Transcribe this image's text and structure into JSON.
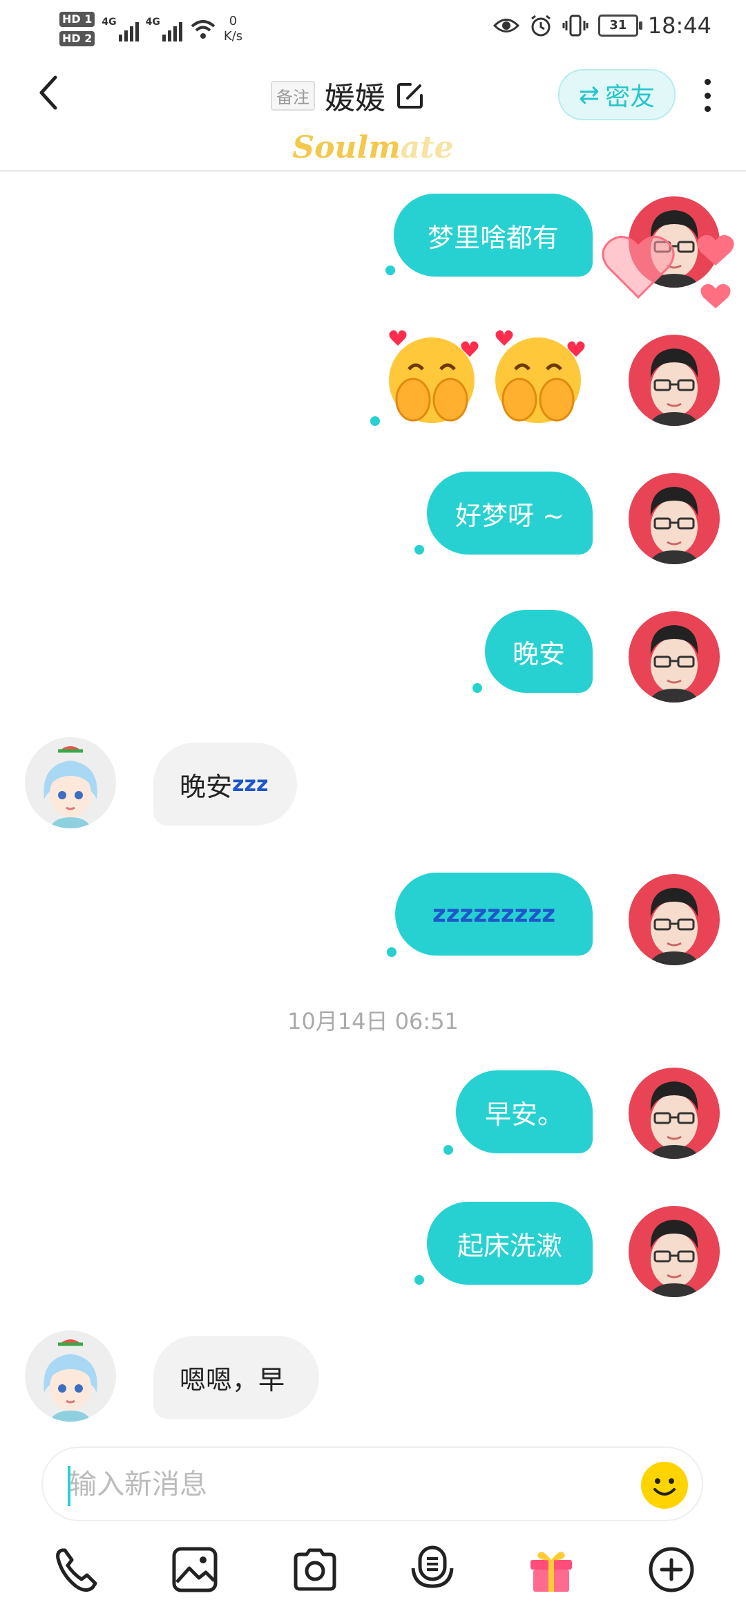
{
  "status_bar": {
    "hd1": "HD 1",
    "hd2": "HD 2",
    "net1": "4G",
    "net2": "4G",
    "speed_value": "0",
    "speed_unit": "K/s",
    "battery": "31",
    "time": "18:44"
  },
  "header": {
    "remark_label": "备注",
    "title": "媛媛",
    "relation_icon": "⇄",
    "relation_label": "密友",
    "brand_part1": "Soulm",
    "brand_part2": "ate"
  },
  "messages": [
    {
      "side": "me",
      "text": "梦里啥都有"
    },
    {
      "side": "me",
      "type": "emoji",
      "icons": [
        "smiling-face-hearts",
        "smiling-face-hearts"
      ]
    },
    {
      "side": "me",
      "text": "好梦呀 ~"
    },
    {
      "side": "me",
      "text": "晚安"
    },
    {
      "side": "her",
      "text": "晚安",
      "suffix": "zzz"
    },
    {
      "side": "me",
      "text": "zzzzzzzzz"
    },
    {
      "side": "system",
      "text": "10月14日 06:51"
    },
    {
      "side": "me",
      "text": "早安。"
    },
    {
      "side": "me",
      "text": "起床洗漱"
    },
    {
      "side": "her",
      "text": "嗯嗯，早"
    }
  ],
  "input": {
    "placeholder": "输入新消息"
  },
  "toolbar_icons": [
    "phone-icon",
    "image-icon",
    "camera-icon",
    "voice-icon",
    "gift-icon",
    "plus-icon"
  ],
  "colors": {
    "accent": "#27d1d1",
    "my_avatar_bg": "#e84455",
    "zz_blue": "#1d57c9"
  }
}
